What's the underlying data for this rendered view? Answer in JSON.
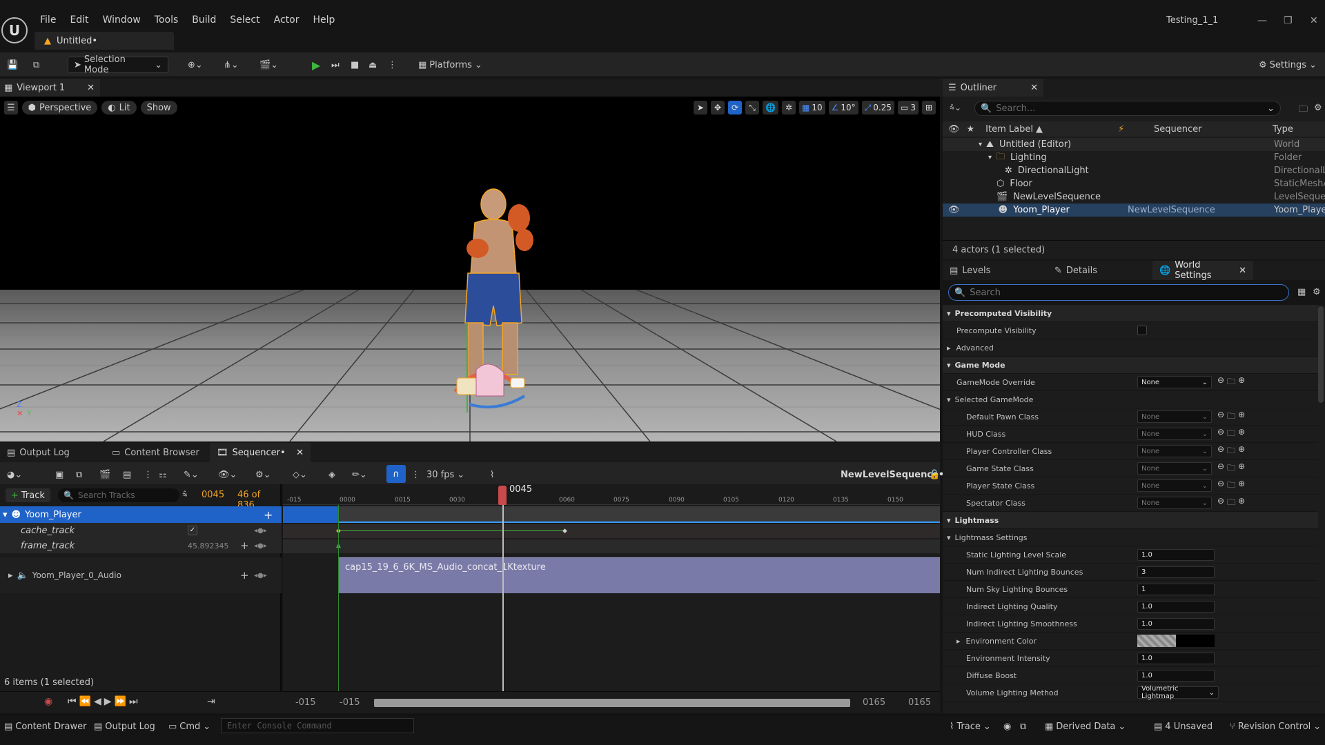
{
  "app": {
    "project_name": "Testing_1_1",
    "doc_tab": "Untitled•"
  },
  "menu": [
    "File",
    "Edit",
    "Window",
    "Tools",
    "Build",
    "Select",
    "Actor",
    "Help"
  ],
  "toolbar": {
    "selection_mode": "Selection Mode",
    "platforms": "Platforms",
    "settings": "Settings"
  },
  "viewport": {
    "tab_label": "Viewport 1",
    "perspective": "Perspective",
    "lit": "Lit",
    "show": "Show",
    "grid_snap": "10",
    "rot_snap": "10°",
    "scale_snap": "0.25",
    "cam_speed": "3",
    "axis_z": "Z",
    "axis_y": "Y"
  },
  "bottom_tabs": {
    "output_log": "Output Log",
    "content_browser": "Content Browser",
    "sequencer": "Sequencer•"
  },
  "sequencer": {
    "fps": "30 fps",
    "sequence_name": "NewLevelSequence•",
    "add_track": "Track",
    "search_placeholder": "Search Tracks",
    "current_frame": "0045",
    "frame_of": "46 of 836",
    "playhead_label": "0045",
    "ruler": [
      "-015",
      "0000",
      "0015",
      "0030",
      "0060",
      "0075",
      "0090",
      "0105",
      "0120",
      "0135",
      "0150"
    ],
    "tracks": {
      "player": "Yoom_Player",
      "cache_track": "cache_track",
      "frame_track": "frame_track",
      "frame_value": "45.892345",
      "audio": "Yoom_Player_0_Audio"
    },
    "audio_clip": "cap15_19_6_6K_MS_Audio_concat_1Ktexture",
    "items_count": "6 items (1 selected)",
    "range_start_a": "-015",
    "range_start_b": "-015",
    "range_end_a": "0165",
    "range_end_b": "0165"
  },
  "statusbar": {
    "content_drawer": "Content Drawer",
    "output_log": "Output Log",
    "cmd": "Cmd",
    "console_placeholder": "Enter Console Command",
    "trace": "Trace",
    "derived_data": "Derived Data",
    "unsaved": "4 Unsaved",
    "revision_control": "Revision Control"
  },
  "outliner": {
    "tab_label": "Outliner",
    "search_placeholder": "Search...",
    "col_label": "Item Label",
    "col_sequencer": "Sequencer",
    "col_type": "Type",
    "rows": [
      {
        "label": "Untitled (Editor)",
        "seq": "",
        "type": "World"
      },
      {
        "label": "Lighting",
        "seq": "",
        "type": "Folder"
      },
      {
        "label": "DirectionalLight",
        "seq": "",
        "type": "DirectionalLi"
      },
      {
        "label": "Floor",
        "seq": "",
        "type": "StaticMeshA"
      },
      {
        "label": "NewLevelSequence",
        "seq": "",
        "type": "LevelSequer"
      },
      {
        "label": "Yoom_Player",
        "seq": "NewLevelSequence",
        "type": "Yoom_Playe"
      }
    ],
    "count": "4 actors (1 selected)"
  },
  "details_tabs": {
    "levels": "Levels",
    "details": "Details",
    "world_settings": "World Settings"
  },
  "world_settings": {
    "search_placeholder": "Search",
    "precomputed_visibility": "Precomputed Visibility",
    "precompute_visibility": "Precompute Visibility",
    "advanced": "Advanced",
    "game_mode": "Game Mode",
    "gamemode_override": "GameMode Override",
    "gamemode_override_value": "None",
    "selected_gamemode": "Selected GameMode",
    "gm_rows": [
      {
        "label": "Default Pawn Class",
        "value": "None"
      },
      {
        "label": "HUD Class",
        "value": "None"
      },
      {
        "label": "Player Controller Class",
        "value": "None"
      },
      {
        "label": "Game State Class",
        "value": "None"
      },
      {
        "label": "Player State Class",
        "value": "None"
      },
      {
        "label": "Spectator Class",
        "value": "None"
      }
    ],
    "lightmass": "Lightmass",
    "lightmass_settings": "Lightmass Settings",
    "lm_rows": [
      {
        "label": "Static Lighting Level Scale",
        "value": "1.0"
      },
      {
        "label": "Num Indirect Lighting Bounces",
        "value": "3"
      },
      {
        "label": "Num Sky Lighting Bounces",
        "value": "1"
      },
      {
        "label": "Indirect Lighting Quality",
        "value": "1.0"
      },
      {
        "label": "Indirect Lighting Smoothness",
        "value": "1.0"
      }
    ],
    "environment_color": "Environment Color",
    "lm_rows2": [
      {
        "label": "Environment Intensity",
        "value": "1.0"
      },
      {
        "label": "Diffuse Boost",
        "value": "1.0"
      }
    ],
    "volume_lighting_method": "Volume Lighting Method",
    "volume_lighting_value": "Volumetric Lightmap"
  },
  "colors": {
    "accent": "#1f63c9",
    "play_green": "#3fb63f",
    "orange": "#f5a623",
    "audio_clip": "#7a7aa8",
    "selection": "#26405f"
  }
}
